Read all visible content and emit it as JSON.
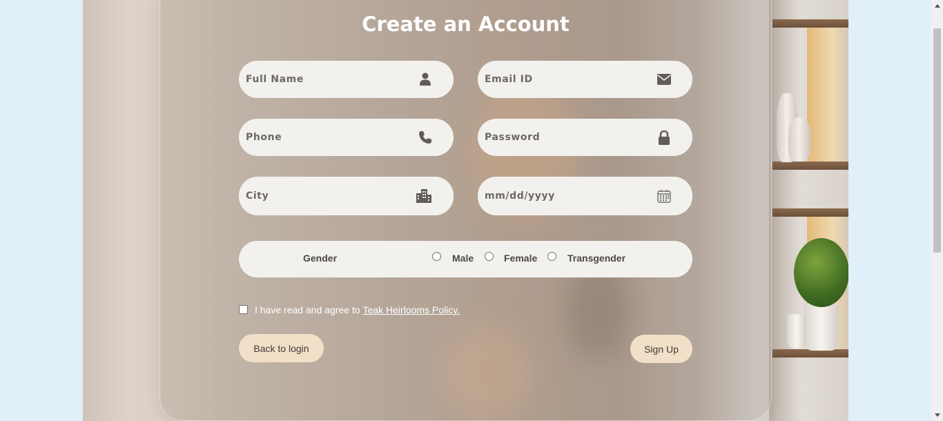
{
  "form": {
    "title": "Create an Account",
    "fields": {
      "full_name": {
        "placeholder": "Full Name",
        "icon": "user-icon"
      },
      "email": {
        "placeholder": "Email ID",
        "icon": "envelope-icon"
      },
      "phone": {
        "placeholder": "Phone",
        "icon": "phone-icon"
      },
      "password": {
        "placeholder": "Password",
        "icon": "lock-icon"
      },
      "city": {
        "placeholder": "City",
        "icon": "city-icon"
      },
      "dob": {
        "placeholder": "mm/dd/yyyy",
        "icon": "calendar-icon"
      }
    },
    "gender": {
      "label": "Gender",
      "options": [
        "Male",
        "Female",
        "Transgender"
      ]
    },
    "agreement": {
      "text": "I have read and agree to",
      "link": "Teak Heirlooms Policy."
    },
    "buttons": {
      "back": "Back to login",
      "signup": "Sign Up"
    }
  },
  "colors": {
    "page_bg": "#e1f0f8",
    "field_bg": "#f2f1ee",
    "button_bg": "#f1dfc7",
    "title": "#ffffff"
  }
}
